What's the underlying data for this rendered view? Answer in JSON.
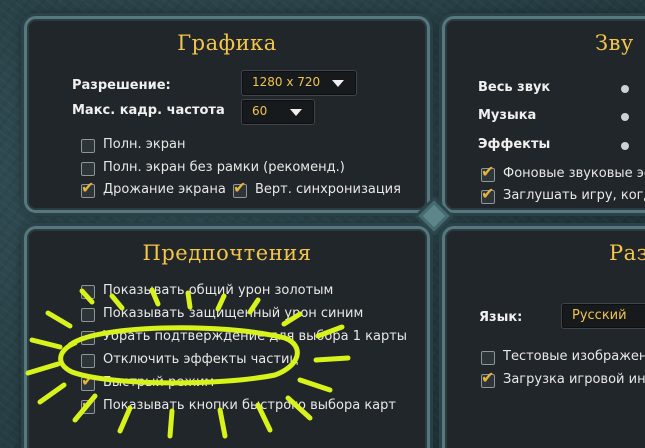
{
  "graphics": {
    "title": "Графика",
    "resolution_label": "Разрешение:",
    "resolution_value": "1280 x 720",
    "fps_label": "Макс. кадр. частота",
    "fps_value": "60",
    "checkboxes": [
      {
        "label": "Полн. экран",
        "checked": false
      },
      {
        "label": "Полн. экран без рамки (рекоменд.)",
        "checked": false
      },
      {
        "label": "Дрожание экрана",
        "checked": true
      },
      {
        "label": "Верт. синхронизация",
        "checked": true
      }
    ]
  },
  "sound": {
    "title": "Зву",
    "master_label": "Весь звук",
    "music_label": "Музыка",
    "effects_label": "Эффекты",
    "checkboxes": [
      {
        "label": "Фоновые звуковые эфф",
        "checked": true
      },
      {
        "label": "Заглушать игру, когда ок",
        "checked": true
      }
    ]
  },
  "preferences": {
    "title": "Предпочтения",
    "checkboxes": [
      {
        "label": "Показывать общий урон золотым",
        "checked": false
      },
      {
        "label": "Показывать защищенный урон синим",
        "checked": false
      },
      {
        "label": "Убрать подтверждение для выбора 1 карты",
        "checked": false
      },
      {
        "label": "Отключить эффекты частиц",
        "checked": false
      },
      {
        "label": "Быстрый режим",
        "checked": true
      },
      {
        "label": "Показывать кнопки быстрого выбора карт",
        "checked": true
      }
    ]
  },
  "misc": {
    "title": "Разн",
    "language_label": "Язык:",
    "language_value": "Русский",
    "checkboxes": [
      {
        "label": "Тестовые изображения",
        "checked": false
      },
      {
        "label": "Загрузка игровой инфор",
        "checked": true
      }
    ]
  },
  "colors": {
    "accent_title": "#f4c54a",
    "checkmark": "#e7b43a",
    "highlight_scribble": "#d8f21c"
  }
}
